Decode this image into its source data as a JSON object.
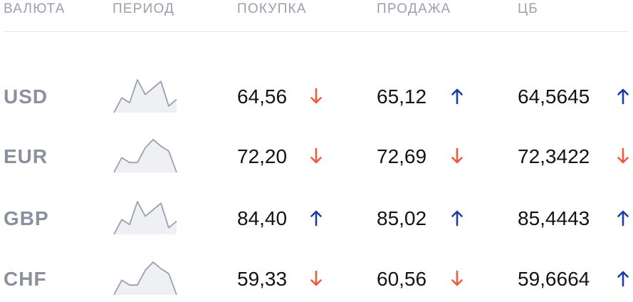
{
  "header": {
    "currency": "ВАЛЮТА",
    "period": "ПЕРИОД",
    "buy": "ПОКУПКА",
    "sell": "ПРОДАЖА",
    "cb": "ЦБ"
  },
  "colors": {
    "up_arrow": "#1a3ea8",
    "down_arrow": "#f05a3c",
    "code_text": "#8a909d",
    "header_text": "#9aa0ad",
    "sparkline": "#9aa0ad"
  },
  "rows": [
    {
      "code": "USD",
      "trend": [
        0.0,
        0.45,
        0.3,
        1.0,
        0.55,
        0.75,
        0.95,
        0.2,
        0.4
      ],
      "buy": "64,56",
      "buy_dir": "down",
      "sell": "65,12",
      "sell_dir": "up",
      "cb": "64,5645",
      "cb_dir": "up"
    },
    {
      "code": "EUR",
      "trend": [
        0.0,
        0.45,
        0.3,
        0.3,
        0.75,
        1.0,
        0.8,
        0.65,
        0.0
      ],
      "buy": "72,20",
      "buy_dir": "down",
      "sell": "72,69",
      "sell_dir": "down",
      "cb": "72,3422",
      "cb_dir": "down"
    },
    {
      "code": "GBP",
      "trend": [
        0.0,
        0.45,
        0.3,
        1.0,
        0.55,
        0.75,
        0.95,
        0.2,
        0.4
      ],
      "buy": "84,40",
      "buy_dir": "up",
      "sell": "85,02",
      "sell_dir": "up",
      "cb": "85,4443",
      "cb_dir": "up"
    },
    {
      "code": "CHF",
      "trend": [
        0.0,
        0.45,
        0.3,
        0.3,
        0.75,
        1.0,
        0.8,
        0.65,
        0.0
      ],
      "buy": "59,33",
      "buy_dir": "down",
      "sell": "60,56",
      "sell_dir": "down",
      "cb": "59,6664",
      "cb_dir": "up"
    }
  ]
}
